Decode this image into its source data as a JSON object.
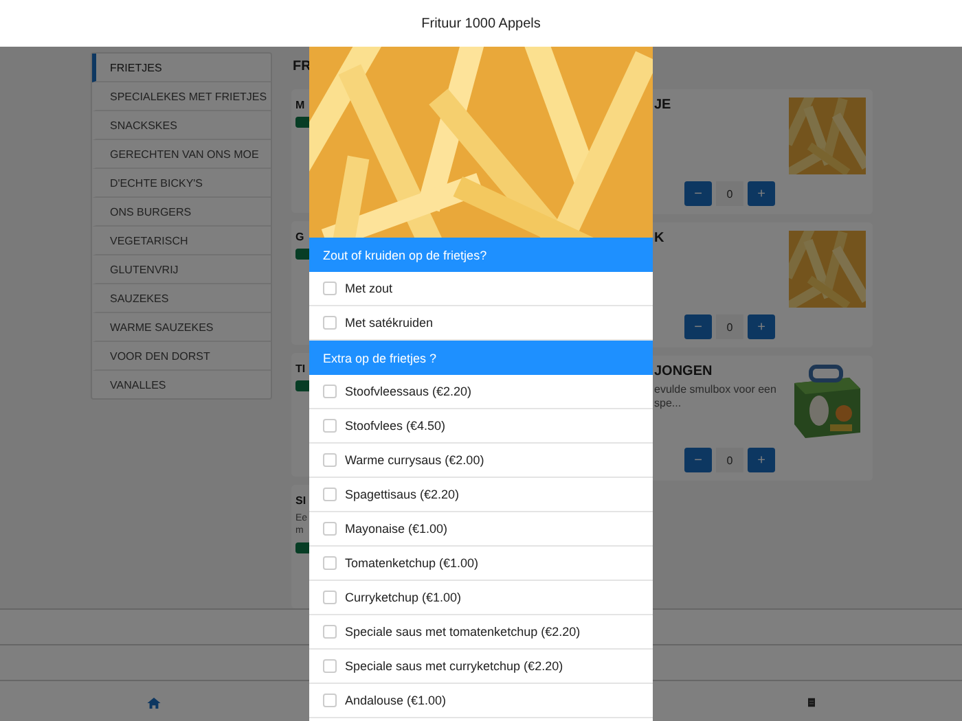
{
  "header": {
    "title": "Frituur 1000 Appels"
  },
  "sidebar": {
    "items": [
      {
        "label": "FRIETJES",
        "selected": true
      },
      {
        "label": "SPECIALEKES MET FRIETJES",
        "selected": false
      },
      {
        "label": "SNACKSKES",
        "selected": false
      },
      {
        "label": "GERECHTEN VAN ONS MOE",
        "selected": false
      },
      {
        "label": "D'ECHTE BICKY'S",
        "selected": false
      },
      {
        "label": "ONS BURGERS",
        "selected": false
      },
      {
        "label": "VEGETARISCH",
        "selected": false
      },
      {
        "label": "GLUTENVRIJ",
        "selected": false
      },
      {
        "label": "SAUZEKES",
        "selected": false
      },
      {
        "label": "WARME SAUZEKES",
        "selected": false
      },
      {
        "label": "VOOR DEN DORST",
        "selected": false
      },
      {
        "label": "VANALLES",
        "selected": false
      }
    ]
  },
  "content": {
    "heading": "FR",
    "left_cards": [
      {
        "title": "M",
        "badge": true
      },
      {
        "title": "G",
        "badge": true
      },
      {
        "title": "TI",
        "badge": true
      },
      {
        "title": "SI",
        "description": "Ee\nm",
        "badge": true
      }
    ],
    "right_cards": [
      {
        "title": "JE",
        "decrease": "−",
        "quantity": "0",
        "increase": "+"
      },
      {
        "title": "K",
        "decrease": "−",
        "quantity": "0",
        "increase": "+"
      },
      {
        "title": "JONGEN",
        "description": "evulde smulbox voor een\nspe...",
        "decrease": "−",
        "quantity": "0",
        "increase": "+"
      }
    ]
  },
  "modal": {
    "sections": [
      {
        "title": "Zout of kruiden op de frietjes?",
        "options": [
          {
            "label": "Met zout",
            "checked": false
          },
          {
            "label": "Met satékruiden",
            "checked": false
          }
        ]
      },
      {
        "title": "Extra op de frietjes ?",
        "options": [
          {
            "label": "Stoofvleessaus (€2.20)",
            "checked": false
          },
          {
            "label": "Stoofvlees (€4.50)",
            "checked": false
          },
          {
            "label": "Warme currysaus (€2.00)",
            "checked": false
          },
          {
            "label": "Spagettisaus (€2.20)",
            "checked": false
          },
          {
            "label": "Mayonaise (€1.00)",
            "checked": false
          },
          {
            "label": "Tomatenketchup (€1.00)",
            "checked": false
          },
          {
            "label": "Curryketchup (€1.00)",
            "checked": false
          },
          {
            "label": "Speciale saus met tomatenketchup (€2.20)",
            "checked": false
          },
          {
            "label": "Speciale saus met curryketchup (€2.20)",
            "checked": false
          },
          {
            "label": "Andalouse (€1.00)",
            "checked": false
          }
        ]
      }
    ]
  }
}
